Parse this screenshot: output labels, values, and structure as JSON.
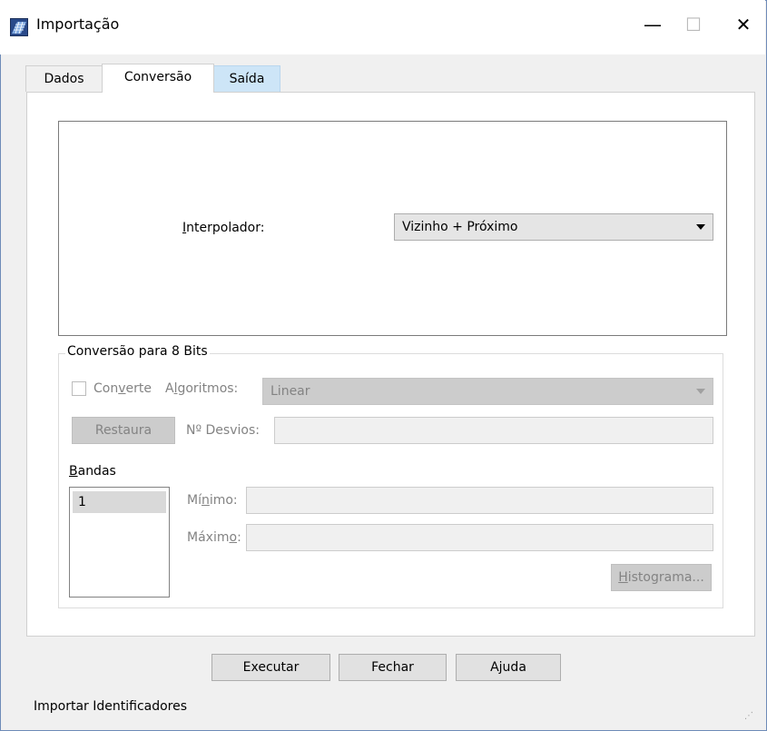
{
  "window": {
    "title": "Importação",
    "controls": {
      "minimize": "—",
      "maximize": "☐",
      "close": "✕"
    }
  },
  "tabs": [
    {
      "label": "Dados"
    },
    {
      "label": "Conversão",
      "active": true
    },
    {
      "label": "Saída"
    }
  ],
  "interpolador": {
    "label_mn": "I",
    "label_rest": "nterpolador:",
    "value": "Vizinho + Próximo"
  },
  "conversao": {
    "group_title": "Conversão para 8 Bits",
    "converte_pre": "Con",
    "converte_mn": "v",
    "converte_post": "erte",
    "algoritmos_pre": "A",
    "algoritmos_mn": "l",
    "algoritmos_post": "goritmos:",
    "algoritmos_value": "Linear",
    "restaura_label": "Restaura",
    "desvios_label": "Nº Desvios:",
    "bandas_mn": "B",
    "bandas_rest": "andas",
    "bandas_items": [
      "1"
    ],
    "minimo_pre": "Mí",
    "minimo_mn": "n",
    "minimo_post": "imo:",
    "maximo_pre": "Máxim",
    "maximo_mn": "o",
    "maximo_post": ":",
    "histograma_mn": "H",
    "histograma_rest": "istograma..."
  },
  "buttons": {
    "executar": "Executar",
    "fechar": "Fechar",
    "ajuda": "Ajuda"
  },
  "status": {
    "text": "Importar Identificadores"
  },
  "colors": {
    "active_tab_bg": "#ffffff",
    "hover_tab_bg": "#cde5f7",
    "disabled_text": "#838383"
  }
}
